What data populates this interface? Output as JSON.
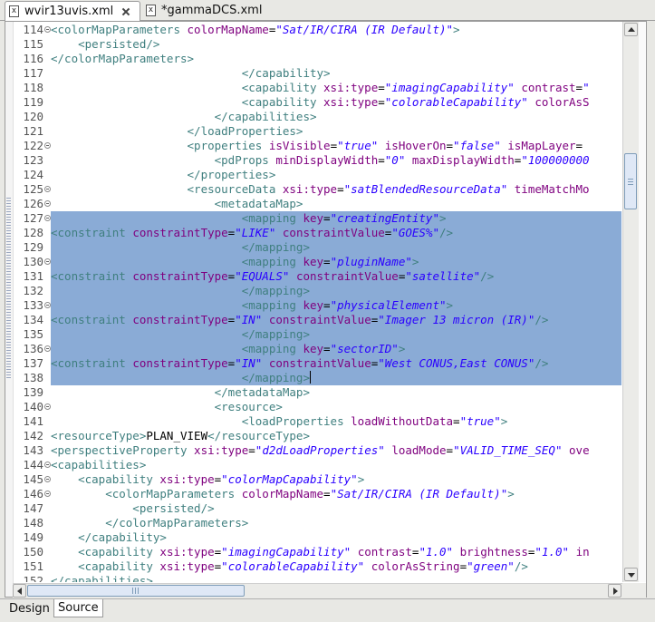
{
  "tabs": [
    {
      "label": "wvir13uvis.xml",
      "active": true,
      "icon": "xml-file-icon"
    },
    {
      "label": "*gammaDCS.xml",
      "active": false,
      "icon": "xml-file-icon"
    }
  ],
  "bottom_tabs": [
    {
      "label": "Design",
      "active": false
    },
    {
      "label": "Source",
      "active": true
    }
  ],
  "selection": {
    "from_line": 127,
    "to_line": 138,
    "caret_line": 138
  },
  "colors": {
    "tag": "#3f7f7f",
    "attribute": "#7f007f",
    "value": "#2a00ff",
    "selection": "#8aabd6"
  },
  "lines": [
    {
      "n": "114",
      "fold": true,
      "tokens": [
        [
          "t",
          "<colorMapParameters "
        ],
        [
          "a",
          "colorMapName"
        ],
        [
          "p",
          "="
        ],
        [
          "v",
          "\"Sat/IR/CIRA (IR Default)\""
        ],
        [
          "t",
          ">"
        ]
      ]
    },
    {
      "n": "115",
      "fold": false,
      "tokens": [
        [
          "t",
          "    <persisted/>"
        ]
      ]
    },
    {
      "n": "116",
      "fold": false,
      "tokens": [
        [
          "t",
          "</colorMapParameters>"
        ]
      ]
    },
    {
      "n": "117",
      "fold": false,
      "tokens": [
        [
          "t",
          "                            </capability>"
        ]
      ]
    },
    {
      "n": "118",
      "fold": false,
      "tokens": [
        [
          "t",
          "                            <capability "
        ],
        [
          "a",
          "xsi:type"
        ],
        [
          "p",
          "="
        ],
        [
          "v",
          "\"imagingCapability\""
        ],
        [
          "p",
          " "
        ],
        [
          "a",
          "contrast"
        ],
        [
          "p",
          "="
        ],
        [
          "v",
          "\""
        ]
      ]
    },
    {
      "n": "119",
      "fold": false,
      "tokens": [
        [
          "t",
          "                            <capability "
        ],
        [
          "a",
          "xsi:type"
        ],
        [
          "p",
          "="
        ],
        [
          "v",
          "\"colorableCapability\""
        ],
        [
          "p",
          " "
        ],
        [
          "a",
          "colorAsS"
        ]
      ]
    },
    {
      "n": "120",
      "fold": false,
      "tokens": [
        [
          "t",
          "                        </capabilities>"
        ]
      ]
    },
    {
      "n": "121",
      "fold": false,
      "tokens": [
        [
          "t",
          "                    </loadProperties>"
        ]
      ]
    },
    {
      "n": "122",
      "fold": true,
      "tokens": [
        [
          "t",
          "                    <properties "
        ],
        [
          "a",
          "isVisible"
        ],
        [
          "p",
          "="
        ],
        [
          "v",
          "\"true\""
        ],
        [
          "p",
          " "
        ],
        [
          "a",
          "isHoverOn"
        ],
        [
          "p",
          "="
        ],
        [
          "v",
          "\"false\""
        ],
        [
          "p",
          " "
        ],
        [
          "a",
          "isMapLayer"
        ],
        [
          "p",
          "="
        ]
      ]
    },
    {
      "n": "123",
      "fold": false,
      "tokens": [
        [
          "t",
          "                        <pdProps "
        ],
        [
          "a",
          "minDisplayWidth"
        ],
        [
          "p",
          "="
        ],
        [
          "v",
          "\"0\""
        ],
        [
          "p",
          " "
        ],
        [
          "a",
          "maxDisplayWidth"
        ],
        [
          "p",
          "="
        ],
        [
          "v",
          "\"100000000"
        ]
      ]
    },
    {
      "n": "124",
      "fold": false,
      "tokens": [
        [
          "t",
          "                    </properties>"
        ]
      ]
    },
    {
      "n": "125",
      "fold": true,
      "tokens": [
        [
          "t",
          "                    <resourceData "
        ],
        [
          "a",
          "xsi:type"
        ],
        [
          "p",
          "="
        ],
        [
          "v",
          "\"satBlendedResourceData\""
        ],
        [
          "p",
          " "
        ],
        [
          "a",
          "timeMatchMo"
        ]
      ]
    },
    {
      "n": "126",
      "fold": true,
      "tokens": [
        [
          "t",
          "                        <metadataMap>"
        ]
      ]
    },
    {
      "n": "127",
      "fold": true,
      "tokens": [
        [
          "t",
          "                            <mapping "
        ],
        [
          "a",
          "key"
        ],
        [
          "p",
          "="
        ],
        [
          "v",
          "\"creatingEntity\""
        ],
        [
          "t",
          ">"
        ]
      ]
    },
    {
      "n": "128",
      "fold": false,
      "tokens": [
        [
          "t",
          "<constraint "
        ],
        [
          "a",
          "constraintType"
        ],
        [
          "p",
          "="
        ],
        [
          "v",
          "\"LIKE\""
        ],
        [
          "p",
          " "
        ],
        [
          "a",
          "constraintValue"
        ],
        [
          "p",
          "="
        ],
        [
          "v",
          "\"GOES%\""
        ],
        [
          "t",
          "/>"
        ]
      ]
    },
    {
      "n": "129",
      "fold": false,
      "tokens": [
        [
          "t",
          "                            </mapping>"
        ]
      ]
    },
    {
      "n": "130",
      "fold": true,
      "tokens": [
        [
          "t",
          "                            <mapping "
        ],
        [
          "a",
          "key"
        ],
        [
          "p",
          "="
        ],
        [
          "v",
          "\"pluginName\""
        ],
        [
          "t",
          ">"
        ]
      ]
    },
    {
      "n": "131",
      "fold": false,
      "tokens": [
        [
          "t",
          "<constraint "
        ],
        [
          "a",
          "constraintType"
        ],
        [
          "p",
          "="
        ],
        [
          "v",
          "\"EQUALS\""
        ],
        [
          "p",
          " "
        ],
        [
          "a",
          "constraintValue"
        ],
        [
          "p",
          "="
        ],
        [
          "v",
          "\"satellite\""
        ],
        [
          "t",
          "/>"
        ]
      ]
    },
    {
      "n": "132",
      "fold": false,
      "tokens": [
        [
          "t",
          "                            </mapping>"
        ]
      ]
    },
    {
      "n": "133",
      "fold": true,
      "tokens": [
        [
          "t",
          "                            <mapping "
        ],
        [
          "a",
          "key"
        ],
        [
          "p",
          "="
        ],
        [
          "v",
          "\"physicalElement\""
        ],
        [
          "t",
          ">"
        ]
      ]
    },
    {
      "n": "134",
      "fold": false,
      "tokens": [
        [
          "t",
          "<constraint "
        ],
        [
          "a",
          "constraintType"
        ],
        [
          "p",
          "="
        ],
        [
          "v",
          "\"IN\""
        ],
        [
          "p",
          " "
        ],
        [
          "a",
          "constraintValue"
        ],
        [
          "p",
          "="
        ],
        [
          "v",
          "\"Imager 13 micron (IR)\""
        ],
        [
          "t",
          "/>"
        ]
      ]
    },
    {
      "n": "135",
      "fold": false,
      "tokens": [
        [
          "t",
          "                            </mapping>"
        ]
      ]
    },
    {
      "n": "136",
      "fold": true,
      "tokens": [
        [
          "t",
          "                            <mapping "
        ],
        [
          "a",
          "key"
        ],
        [
          "p",
          "="
        ],
        [
          "v",
          "\"sectorID\""
        ],
        [
          "t",
          ">"
        ]
      ]
    },
    {
      "n": "137",
      "fold": false,
      "tokens": [
        [
          "t",
          "<constraint "
        ],
        [
          "a",
          "constraintType"
        ],
        [
          "p",
          "="
        ],
        [
          "v",
          "\"IN\""
        ],
        [
          "p",
          " "
        ],
        [
          "a",
          "constraintValue"
        ],
        [
          "p",
          "="
        ],
        [
          "v",
          "\"West CONUS,East CONUS\""
        ],
        [
          "t",
          "/>"
        ]
      ]
    },
    {
      "n": "138",
      "fold": false,
      "tokens": [
        [
          "t",
          "                            </mapping>"
        ]
      ]
    },
    {
      "n": "139",
      "fold": false,
      "tokens": [
        [
          "t",
          "                        </metadataMap>"
        ]
      ]
    },
    {
      "n": "140",
      "fold": true,
      "tokens": [
        [
          "t",
          "                        <resource>"
        ]
      ]
    },
    {
      "n": "141",
      "fold": false,
      "tokens": [
        [
          "t",
          "                            <loadProperties "
        ],
        [
          "a",
          "loadWithoutData"
        ],
        [
          "p",
          "="
        ],
        [
          "v",
          "\"true\""
        ],
        [
          "t",
          ">"
        ]
      ]
    },
    {
      "n": "142",
      "fold": false,
      "tokens": [
        [
          "t",
          "<resourceType>"
        ],
        [
          "p",
          "PLAN_VIEW"
        ],
        [
          "t",
          "</resourceType>"
        ]
      ]
    },
    {
      "n": "143",
      "fold": false,
      "tokens": [
        [
          "t",
          "<perspectiveProperty "
        ],
        [
          "a",
          "xsi:type"
        ],
        [
          "p",
          "="
        ],
        [
          "v",
          "\"d2dLoadProperties\""
        ],
        [
          "p",
          " "
        ],
        [
          "a",
          "loadMode"
        ],
        [
          "p",
          "="
        ],
        [
          "v",
          "\"VALID_TIME_SEQ\""
        ],
        [
          "p",
          " "
        ],
        [
          "a",
          "ove"
        ]
      ]
    },
    {
      "n": "144",
      "fold": true,
      "tokens": [
        [
          "t",
          "<capabilities>"
        ]
      ]
    },
    {
      "n": "145",
      "fold": true,
      "tokens": [
        [
          "t",
          "    <capability "
        ],
        [
          "a",
          "xsi:type"
        ],
        [
          "p",
          "="
        ],
        [
          "v",
          "\"colorMapCapability\""
        ],
        [
          "t",
          ">"
        ]
      ]
    },
    {
      "n": "146",
      "fold": true,
      "tokens": [
        [
          "t",
          "        <colorMapParameters "
        ],
        [
          "a",
          "colorMapName"
        ],
        [
          "p",
          "="
        ],
        [
          "v",
          "\"Sat/IR/CIRA (IR Default)\""
        ],
        [
          "t",
          ">"
        ]
      ]
    },
    {
      "n": "147",
      "fold": false,
      "tokens": [
        [
          "t",
          "            <persisted/>"
        ]
      ]
    },
    {
      "n": "148",
      "fold": false,
      "tokens": [
        [
          "t",
          "        </colorMapParameters>"
        ]
      ]
    },
    {
      "n": "149",
      "fold": false,
      "tokens": [
        [
          "t",
          "    </capability>"
        ]
      ]
    },
    {
      "n": "150",
      "fold": false,
      "tokens": [
        [
          "t",
          "    <capability "
        ],
        [
          "a",
          "xsi:type"
        ],
        [
          "p",
          "="
        ],
        [
          "v",
          "\"imagingCapability\""
        ],
        [
          "p",
          " "
        ],
        [
          "a",
          "contrast"
        ],
        [
          "p",
          "="
        ],
        [
          "v",
          "\"1.0\""
        ],
        [
          "p",
          " "
        ],
        [
          "a",
          "brightness"
        ],
        [
          "p",
          "="
        ],
        [
          "v",
          "\"1.0\""
        ],
        [
          "p",
          " "
        ],
        [
          "a",
          "in"
        ]
      ]
    },
    {
      "n": "151",
      "fold": false,
      "tokens": [
        [
          "t",
          "    <capability "
        ],
        [
          "a",
          "xsi:type"
        ],
        [
          "p",
          "="
        ],
        [
          "v",
          "\"colorableCapability\""
        ],
        [
          "p",
          " "
        ],
        [
          "a",
          "colorAsString"
        ],
        [
          "p",
          "="
        ],
        [
          "v",
          "\"green\""
        ],
        [
          "t",
          "/>"
        ]
      ]
    },
    {
      "n": "152",
      "fold": false,
      "tokens": [
        [
          "t",
          "</capabilities>"
        ]
      ]
    }
  ]
}
